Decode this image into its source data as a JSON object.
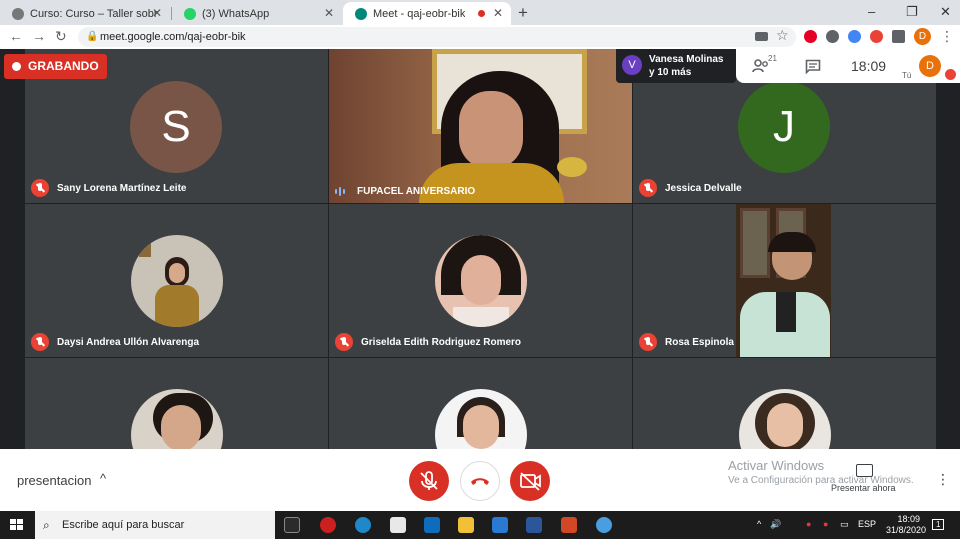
{
  "browser": {
    "tabs": [
      {
        "title": "Curso: Curso – Taller sobre Celiac",
        "active": false
      },
      {
        "title": "(3) WhatsApp",
        "active": false
      },
      {
        "title": "Meet - qaj-eobr-bik",
        "active": true
      }
    ],
    "url": "meet.google.com/qaj-eobr-bik",
    "profile_initial": "D"
  },
  "meet": {
    "recording_label": "GRABANDO",
    "participants_chip": {
      "initial": "V",
      "line1": "Vanesa Molinas",
      "line2": "y 10 más"
    },
    "participant_count": "21",
    "clock": "18:09",
    "self_initial": "D",
    "self_label": "Tú",
    "tiles": [
      {
        "name": "Sany Lorena Martínez Leite",
        "initial": "S",
        "avatar_color": "#795548",
        "muted": true
      },
      {
        "name": "FUPACEL ANIVERSARIO",
        "muted": false
      },
      {
        "name": "Jessica Delvalle",
        "initial": "J",
        "avatar_color": "#33691e",
        "muted": true
      },
      {
        "name": "Daysi Andrea Ullón Alvarenga",
        "muted": true
      },
      {
        "name": "Griselda Edith Rodriguez Romero",
        "muted": true
      },
      {
        "name": "Rosa Espinola",
        "muted": true
      },
      {
        "name": "",
        "muted": true
      },
      {
        "name": "",
        "muted": true
      },
      {
        "name": "",
        "muted": true
      }
    ]
  },
  "controls": {
    "present_label": "presentacion",
    "present_now": "Presentar ahora",
    "activate_title": "Activar Windows",
    "activate_sub": "Ve a Configuración para activar Windows."
  },
  "taskbar": {
    "search_placeholder": "Escribe aquí para buscar",
    "lang": "ESP",
    "time": "18:09",
    "date": "31/8/2020",
    "notification_count": "1"
  },
  "colors": {
    "meet_background": "#202124",
    "tile_background": "#3c4043",
    "danger_red": "#d93025",
    "mic_off_red": "#ea4335"
  }
}
